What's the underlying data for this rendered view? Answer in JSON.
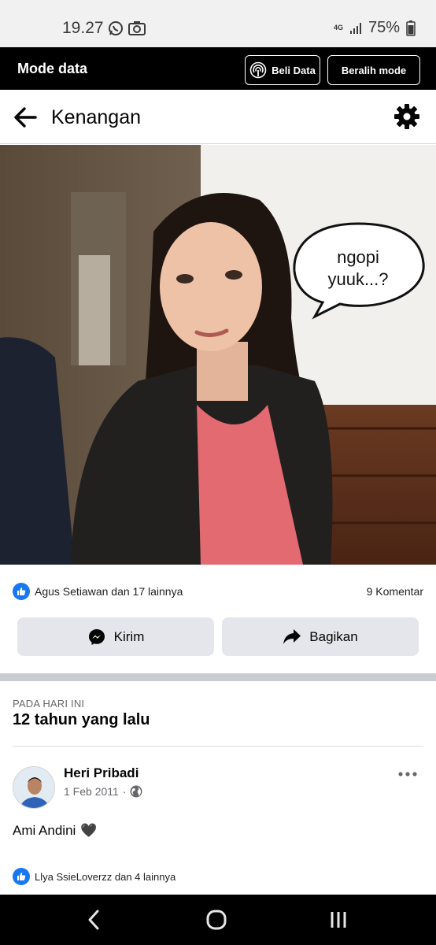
{
  "status_bar": {
    "time": "19.27",
    "network": "4G",
    "battery": "75%"
  },
  "mode_bar": {
    "title": "Mode data",
    "buy_data_label": "Beli Data",
    "switch_mode_label": "Beralih mode"
  },
  "header": {
    "title": "Kenangan"
  },
  "photo": {
    "speech_bubble_text": "ngopi yuuk...?"
  },
  "reactions": {
    "summary": "Agus Setiawan dan 17 lainnya",
    "comments": "9 Komentar"
  },
  "actions": {
    "send_label": "Kirim",
    "share_label": "Bagikan"
  },
  "memory": {
    "label": "PADA HARI INI",
    "title": "12 tahun yang lalu"
  },
  "post": {
    "author": "Heri Pribadi",
    "date": "1 Feb 2011",
    "separator": "·",
    "text": "Ami Andini",
    "emoji": "🖤",
    "reactions_summary": "Llya SsieLoverzz dan 4 lainnya"
  },
  "colors": {
    "facebook_blue": "#1877f2",
    "button_gray": "#e4e6eb"
  }
}
